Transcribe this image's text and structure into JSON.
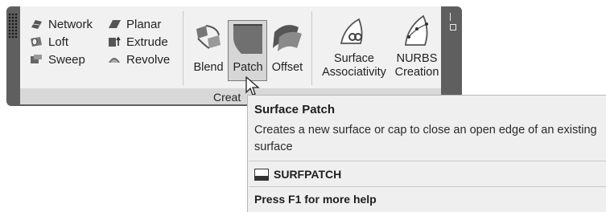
{
  "ribbon": {
    "left_column": [
      {
        "label": "Network",
        "icon": "network-surface-icon"
      },
      {
        "label": "Loft",
        "icon": "loft-surface-icon"
      },
      {
        "label": "Sweep",
        "icon": "sweep-surface-icon"
      }
    ],
    "mid_column": [
      {
        "label": "Planar",
        "icon": "planar-surface-icon"
      },
      {
        "label": "Extrude",
        "icon": "extrude-surface-icon"
      },
      {
        "label": "Revolve",
        "icon": "revolve-surface-icon"
      }
    ],
    "large_buttons": [
      {
        "label": "Blend",
        "icon": "blend-surface-icon"
      },
      {
        "label": "Patch",
        "icon": "patch-surface-icon",
        "state": "hovered"
      },
      {
        "label": "Offset",
        "icon": "offset-surface-icon"
      }
    ],
    "associativity": {
      "line1": "Surface",
      "line2": "Associativity",
      "icon": "surface-associativity-icon"
    },
    "nurbs": {
      "line1": "NURBS",
      "line2": "Creation",
      "icon": "nurbs-creation-icon"
    },
    "panel_title": "Creat"
  },
  "tooltip": {
    "title": "Surface Patch",
    "description": "Creates a new surface or cap to close an open edge of an existing surface",
    "command": "SURFPATCH",
    "help": "Press F1 for more help"
  },
  "colors": {
    "panel_frame": "#5f5f5f",
    "panel_body": "#f1f1f1",
    "tooltip_bg": "#efefef",
    "hover_bg": "#d6d6d6"
  }
}
